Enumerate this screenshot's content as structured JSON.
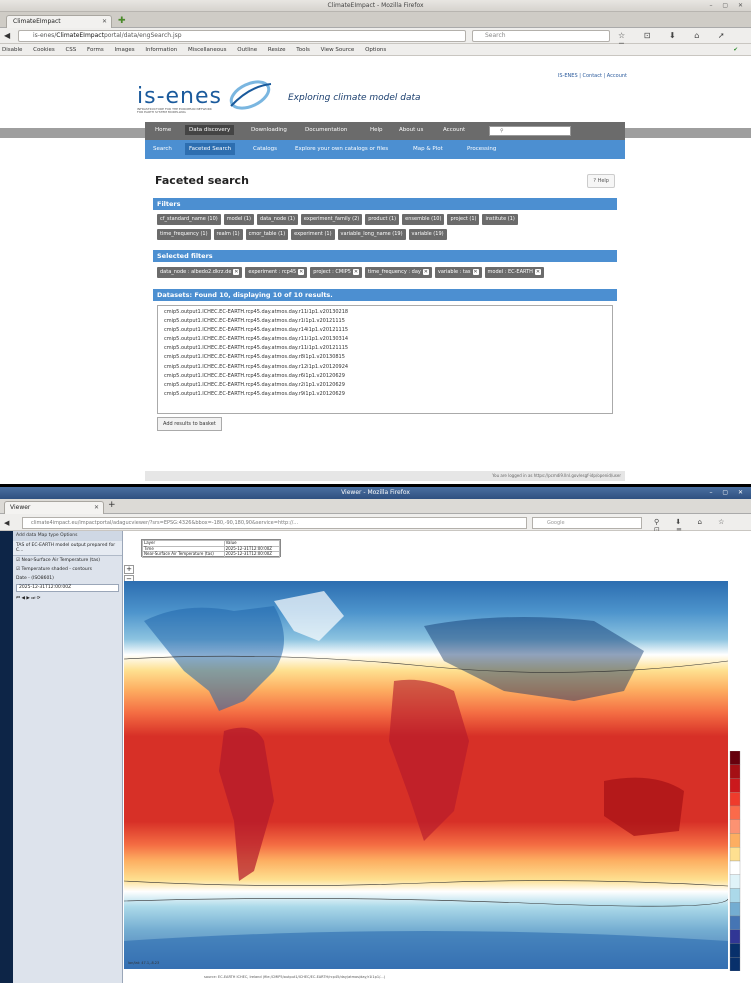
{
  "top": {
    "window_title": "ClimateEImpact - Mozilla Firefox",
    "tab_label": "ClimateEImpact",
    "url_prefix": "is-enes/",
    "url_host": "ClimateEImpact",
    "url_path": "portal/data/engSearch.jsp",
    "search_placeholder": "Search",
    "devbar_items": [
      "Disable",
      "Cookies",
      "CSS",
      "Forms",
      "Images",
      "Information",
      "Miscellaneous",
      "Outline",
      "Resize",
      "Tools",
      "View Source",
      "Options"
    ],
    "top_links": "IS-ENES | Contact | Account",
    "logo_text": "is-enes",
    "tagline": "Exploring climate model data",
    "main_nav": [
      "Home",
      "Data discovery",
      "Downloading",
      "Documentation",
      "Help",
      "About us",
      "Account"
    ],
    "sub_nav": [
      "Search",
      "Faceted Search",
      "Catalogs",
      "Explore your own catalogs or files",
      "Map & Plot",
      "Processing"
    ],
    "page_title": "Faceted search",
    "help_label": "? Help",
    "filters_heading": "Filters",
    "filters_row1": [
      "cf_standard_name (10)",
      "model (1)",
      "data_node (1)",
      "experiment_family (2)",
      "product (1)",
      "ensemble (10)",
      "project (1)",
      "institute (1)"
    ],
    "filters_row2": [
      "time_frequency (1)",
      "realm (1)",
      "cmor_table (1)",
      "experiment (1)",
      "variable_long_name (19)",
      "variable (19)"
    ],
    "selected_heading": "Selected filters",
    "selected_filters": [
      "data_node : albedo2.dkrz.de",
      "experiment : rcp45",
      "project : CMIP5",
      "time_frequency : day",
      "variable : tas",
      "model : EC-EARTH"
    ],
    "datasets_heading": "Datasets: Found 10, displaying 10 of 10 results.",
    "datasets": [
      "cmip5.output1.ICHEC.EC-EARTH.rcp45.day.atmos.day.r11i1p1.v20130218",
      "cmip5.output1.ICHEC.EC-EARTH.rcp45.day.atmos.day.r1i1p1.v20121115",
      "cmip5.output1.ICHEC.EC-EARTH.rcp45.day.atmos.day.r14i1p1.v20121115",
      "cmip5.output1.ICHEC.EC-EARTH.rcp45.day.atmos.day.r11i1p1.v20130314",
      "cmip5.output1.ICHEC.EC-EARTH.rcp45.day.atmos.day.r11i1p1.v20121115",
      "cmip5.output1.ICHEC.EC-EARTH.rcp45.day.atmos.day.r8i1p1.v20130815",
      "cmip5.output1.ICHEC.EC-EARTH.rcp45.day.atmos.day.r12i1p1.v20120924",
      "cmip5.output1.ICHEC.EC-EARTH.rcp45.day.atmos.day.r6i1p1.v20120629",
      "cmip5.output1.ICHEC.EC-EARTH.rcp45.day.atmos.day.r2i1p1.v20120629",
      "cmip5.output1.ICHEC.EC-EARTH.rcp45.day.atmos.day.r9i1p1.v20120629"
    ],
    "add_button": "Add results to basket",
    "footer_text": "You are logged in as https://pcmdi9.llnl.gov/esgf-idp/openid/user"
  },
  "bottom": {
    "window_title": "Viewer - Mozilla Firefox",
    "tab_label": "Viewer",
    "url_text": "climate4impact.eu/impactportal/adagucviewer/?srs=EPSG:4326&bbox=-180,-90,180,90&service=http://...",
    "search_placeholder": "Google",
    "side_toolbar": "Add data  Map type  Options",
    "side_title": "TAS of EC-EARTH model output prepared for C...",
    "layers": [
      "Near-Surface Air Temperature (tas)",
      "Temperature shaded - contours"
    ],
    "time_label": "Date - (ISO8601)",
    "time_value": "2025-12-31T12:00:00Z",
    "feature_info": {
      "headers": [
        "Layer",
        "Value"
      ],
      "rows": [
        [
          "Time",
          "2025-12-31T12:00:00Z"
        ],
        [
          "Near-Surface Air Temperature (tas)",
          "2025-12-31T12:00:00Z"
        ]
      ]
    },
    "map_footer": "source: EC-EARTH ICHEC, Ireland (file:/CMIP5/output1/ICHEC/EC-EARTH/rcp45/day/atmos/day/r1i1p1/...)",
    "coords": "lon/lat: 47.1,-8.23",
    "legend_colors": [
      "#67000d",
      "#a50f15",
      "#cb181d",
      "#ef3b2c",
      "#fb6a4a",
      "#fc9272",
      "#fdae61",
      "#fee090",
      "#ffffff",
      "#e0f3f8",
      "#abd9e9",
      "#74add1",
      "#4575b4",
      "#313695",
      "#08306b",
      "#08306b"
    ]
  }
}
